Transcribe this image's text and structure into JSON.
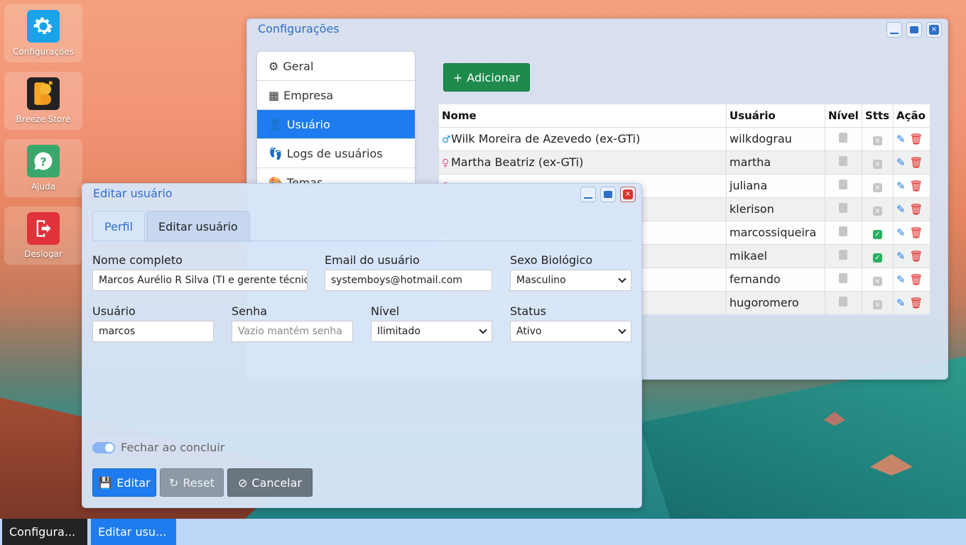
{
  "desktop": {
    "icons": [
      {
        "label": "Configurações",
        "icon": "gear-icon",
        "color": "#1aa3e8"
      },
      {
        "label": "Breeze Store",
        "icon": "breeze-store-icon",
        "color": "#222222"
      },
      {
        "label": "Ajuda",
        "icon": "help-icon",
        "color": "#3aa76d"
      },
      {
        "label": "Deslogar",
        "icon": "logout-icon",
        "color": "#e0323a"
      }
    ]
  },
  "config_window": {
    "title": "Configurações",
    "menu": [
      {
        "label": "Geral",
        "icon": "gear-icon"
      },
      {
        "label": "Empresa",
        "icon": "building-icon"
      },
      {
        "label": "Usuário",
        "icon": "user-icon",
        "active": true
      },
      {
        "label": "Logs de usuários",
        "icon": "footsteps-icon"
      },
      {
        "label": "Temas",
        "icon": "palette-icon"
      }
    ],
    "add_button": "Adicionar",
    "table": {
      "headers": [
        "Nome",
        "Usuário",
        "Nível",
        "Stts",
        "Ação"
      ],
      "rows": [
        {
          "name": "Wilk Moreira de Azevedo (ex-GTi)",
          "gender": "male",
          "user": "wilkdograu",
          "status": "inactive"
        },
        {
          "name": "Martha Beatriz (ex-GTi)",
          "gender": "female",
          "user": "martha",
          "status": "inactive"
        },
        {
          "name": "",
          "gender": "female",
          "user": "juliana",
          "status": "inactive"
        },
        {
          "name": "",
          "gender": "male",
          "user": "klerison",
          "status": "inactive"
        },
        {
          "name": "",
          "gender": "male",
          "user": "marcossiqueira",
          "status": "active"
        },
        {
          "name": "",
          "gender": "male",
          "user": "mikael",
          "status": "active"
        },
        {
          "name": "",
          "gender": "male",
          "user": "fernando",
          "status": "inactive"
        },
        {
          "name": "",
          "gender": "male",
          "user": "hugoromero",
          "status": "inactive"
        }
      ]
    }
  },
  "edit_window": {
    "title": "Editar usuário",
    "tabs": [
      "Perfil",
      "Editar usuário"
    ],
    "fields": {
      "full_name": {
        "label": "Nome completo",
        "value": "Marcos Aurélio R Silva (TI e gerente técnico)"
      },
      "email": {
        "label": "Email do usuário",
        "value": "systemboys@hotmail.com"
      },
      "sex": {
        "label": "Sexo Biológico",
        "value": "Masculino"
      },
      "username": {
        "label": "Usuário",
        "value": "marcos"
      },
      "password": {
        "label": "Senha",
        "placeholder": "Vazio mantém senha"
      },
      "level": {
        "label": "Nível",
        "value": "Ilimitado"
      },
      "status": {
        "label": "Status",
        "value": "Ativo"
      }
    },
    "close_toggle_label": "Fechar ao concluir",
    "buttons": {
      "edit": "Editar",
      "reset": "Reset",
      "cancel": "Cancelar"
    }
  },
  "taskbar": {
    "items": [
      "Configura...",
      "Editar usu..."
    ]
  }
}
